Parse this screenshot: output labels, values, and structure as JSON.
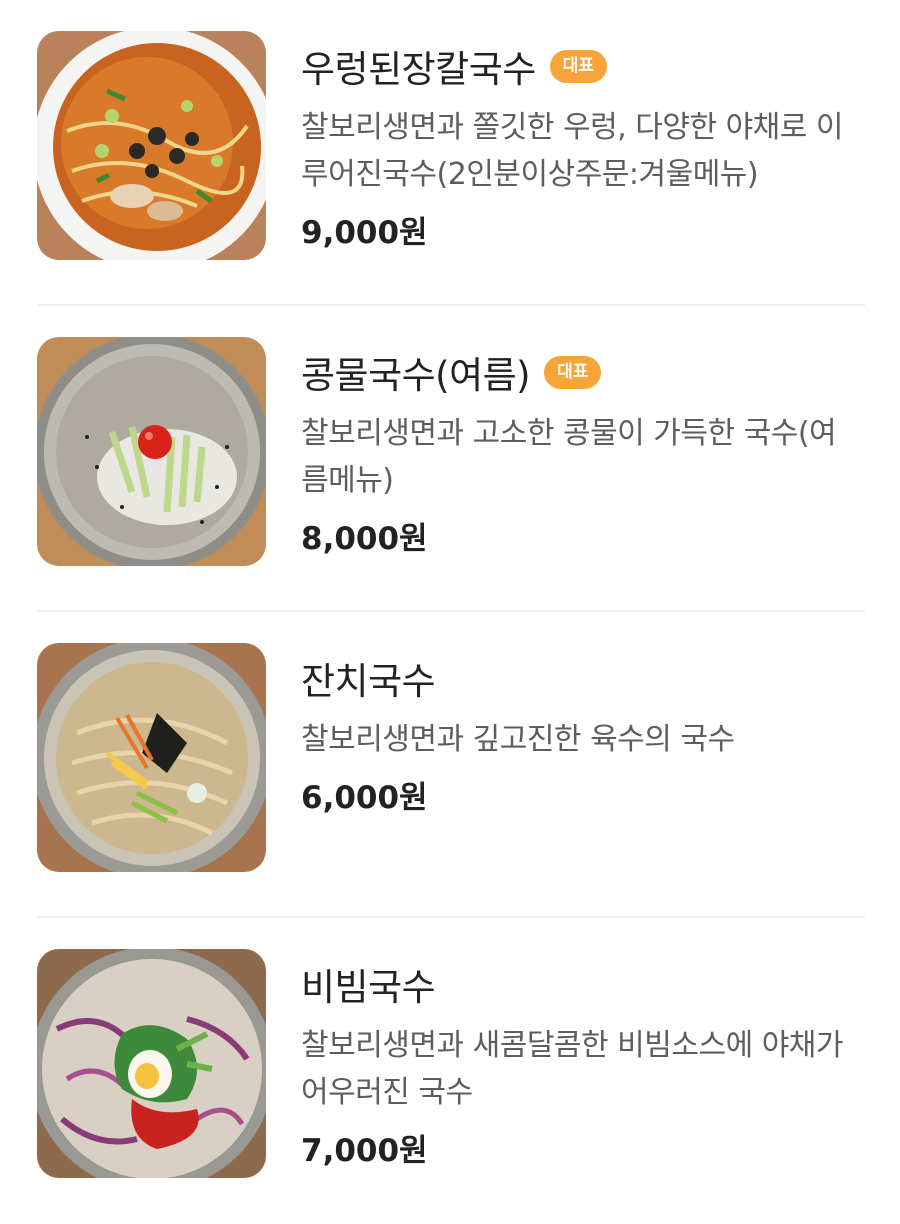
{
  "menu": {
    "items": [
      {
        "name": "우렁된장칼국수",
        "badge": "대표",
        "description": "찰보리생면과 쫄깃한 우렁, 다양한 야채로 이루어진국수(2인분이상주문:겨울메뉴)",
        "price": "9,000원",
        "photo": "doenjang-kalguksu-photo"
      },
      {
        "name": "콩물국수(여름)",
        "badge": "대표",
        "description": "찰보리생면과 고소한 콩물이 가득한 국수(여름메뉴)",
        "price": "8,000원",
        "photo": "kongguksu-photo"
      },
      {
        "name": "잔치국수",
        "description": "찰보리생면과 깊고진한 육수의 국수",
        "price": "6,000원",
        "photo": "janchi-guksu-photo"
      },
      {
        "name": "비빔국수",
        "description": "찰보리생면과 새콤달콤한 비빔소스에 야채가 어우러진 국수",
        "price": "7,000원",
        "photo": "bibim-guksu-photo"
      }
    ]
  },
  "colors": {
    "badge": "#f7a53a",
    "divider": "#efefef",
    "description_text": "#5d5d5d"
  }
}
